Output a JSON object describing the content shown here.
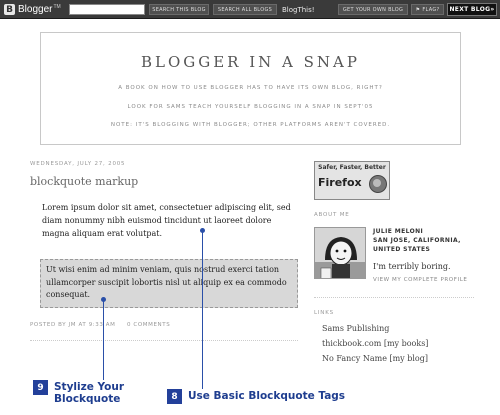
{
  "navbar": {
    "logo_letter": "B",
    "logo_text": "Blogger",
    "logo_tm": "TM",
    "search_this_blog": "SEARCH THIS BLOG",
    "search_all_blogs": "SEARCH ALL BLOGS",
    "blogthis": "BlogThis!",
    "get_your_own_blog": "GET YOUR OWN BLOG",
    "flag": "FLAG?",
    "next_blog": "NEXT BLOG»"
  },
  "header": {
    "title": "BLOGGER IN A SNAP",
    "description_lines": [
      "A BOOK ON HOW TO USE BLOGGER HAS TO HAVE ITS OWN BLOG, RIGHT?",
      "LOOK FOR SAMS TEACH YOURSELF BLOGGING IN A SNAP IN SEPT'05",
      "NOTE: IT'S BLOGGING WITH BLOGGER; OTHER PLATFORMS AREN'T COVERED."
    ]
  },
  "post": {
    "date": "WEDNESDAY, JULY 27, 2005",
    "title": "blockquote markup",
    "paragraph": "Lorem ipsum dolor sit amet, consectetuer adipiscing elit, sed diam nonummy nibh euismod tincidunt ut laoreet dolore magna aliquam erat volutpat.",
    "blockquote": "Ut wisi enim ad minim veniam, quis nostrud exerci tation ullamcorper suscipit lobortis nisl ut aliquip ex ea commodo consequat.",
    "posted_by": "POSTED BY JM AT 9:33 AM",
    "comments": "0 COMMENTS"
  },
  "sidebar": {
    "firefox_tagline": "Safer, Faster, Better",
    "firefox_word": "Firefox",
    "about_me_label": "ABOUT ME",
    "profile_name": "JULIE MELONI",
    "profile_location": "SAN JOSE, CALIFORNIA, UNITED STATES",
    "profile_about": "I'm terribly boring.",
    "view_profile": "VIEW MY COMPLETE PROFILE",
    "links_label": "LINKS",
    "links": [
      "Sams Publishing",
      "thickbook.com [my books]",
      "No Fancy Name [my blog]"
    ]
  },
  "callouts": {
    "nine_number": "9",
    "nine_line1": "Stylize Your",
    "nine_line2": "Blockquote",
    "eight_number": "8",
    "eight_text": "Use Basic Blockquote Tags"
  },
  "colors": {
    "navbar_bg": "#3a3a3a",
    "blockquote_bg": "#d8d8d8",
    "callout_blue": "#23409a"
  }
}
